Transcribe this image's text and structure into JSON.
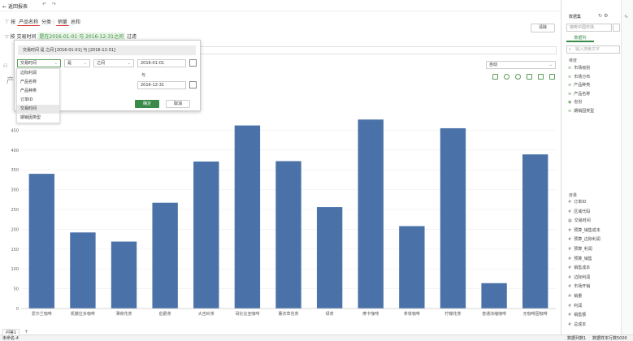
{
  "topbar": {
    "back_label": "返回报表"
  },
  "filters": {
    "row1_prefix": "按",
    "pill1": "产品名称",
    "pill1b": "分类",
    "pill2": "销量",
    "pill2b": "总和",
    "row2_prefix": "按",
    "row2_field": "交易时间",
    "row2_pill": "是在2016-01-01 与 2016-12-31之间",
    "row2_end": "过滤",
    "clear_label": "清除"
  },
  "popup": {
    "header": "交易时间 是 之间 [2016-01-01] 与 [2016-12-31]",
    "field_select": "交易时间",
    "op_select": "是",
    "range_select": "之间",
    "date_from": "2016-01-01",
    "and_label": "与",
    "date_to": "2016-12-31",
    "ok_label": "确定",
    "cancel_label": "取消",
    "options": [
      "边际利润",
      "产品名称",
      "产品种类",
      "订单ID",
      "交易时间",
      "期销因类型"
    ],
    "selected_index": 4
  },
  "view": {
    "auto_select": "自动",
    "side_chars": [
      "问",
      "产"
    ]
  },
  "right": {
    "title": "数据集",
    "source": "咖啡中国市场",
    "tab": "数据列",
    "search_placeholder": "输入搜索文字",
    "dim_header": "维度",
    "dims": [
      "市场级别",
      "市场分布",
      "产品种类",
      "产品名称",
      "省份",
      "期销因类型"
    ],
    "measure_header": "度量",
    "measures": [
      "订单ID",
      "区域代码",
      "交易时间",
      "预算_销售成本",
      "预算_边际利润",
      "预算_利润",
      "预算_销售",
      "销售成本",
      "边际利润",
      "市场开销",
      "销量",
      "利润",
      "销售额",
      "总成本"
    ]
  },
  "status": {
    "tab": "问答1",
    "sheet": "未命名-4",
    "rows_label": "数据列数1",
    "sample": "数据样本行数5000"
  },
  "chart_data": {
    "type": "bar",
    "categories": [
      "爱尔兰咖啡",
      "凯撒拉多咖啡",
      "薄荷花茶",
      "伯爵茶",
      "大吉岭茶",
      "哥伦比亚咖啡",
      "薰衣草花茶",
      "绿茶",
      "摩卡咖啡",
      "拿铁咖啡",
      "柠檬花茶",
      "普通浓缩咖啡",
      "无咖啡因咖啡"
    ],
    "values": [
      340,
      192,
      169,
      267,
      371,
      462,
      372,
      256,
      477,
      208,
      455,
      64,
      389
    ],
    "yticks": [
      0,
      50,
      100,
      150,
      200,
      250,
      300,
      350,
      400,
      450
    ],
    "ylim": [
      0,
      500
    ],
    "color": "#4a72a8"
  }
}
